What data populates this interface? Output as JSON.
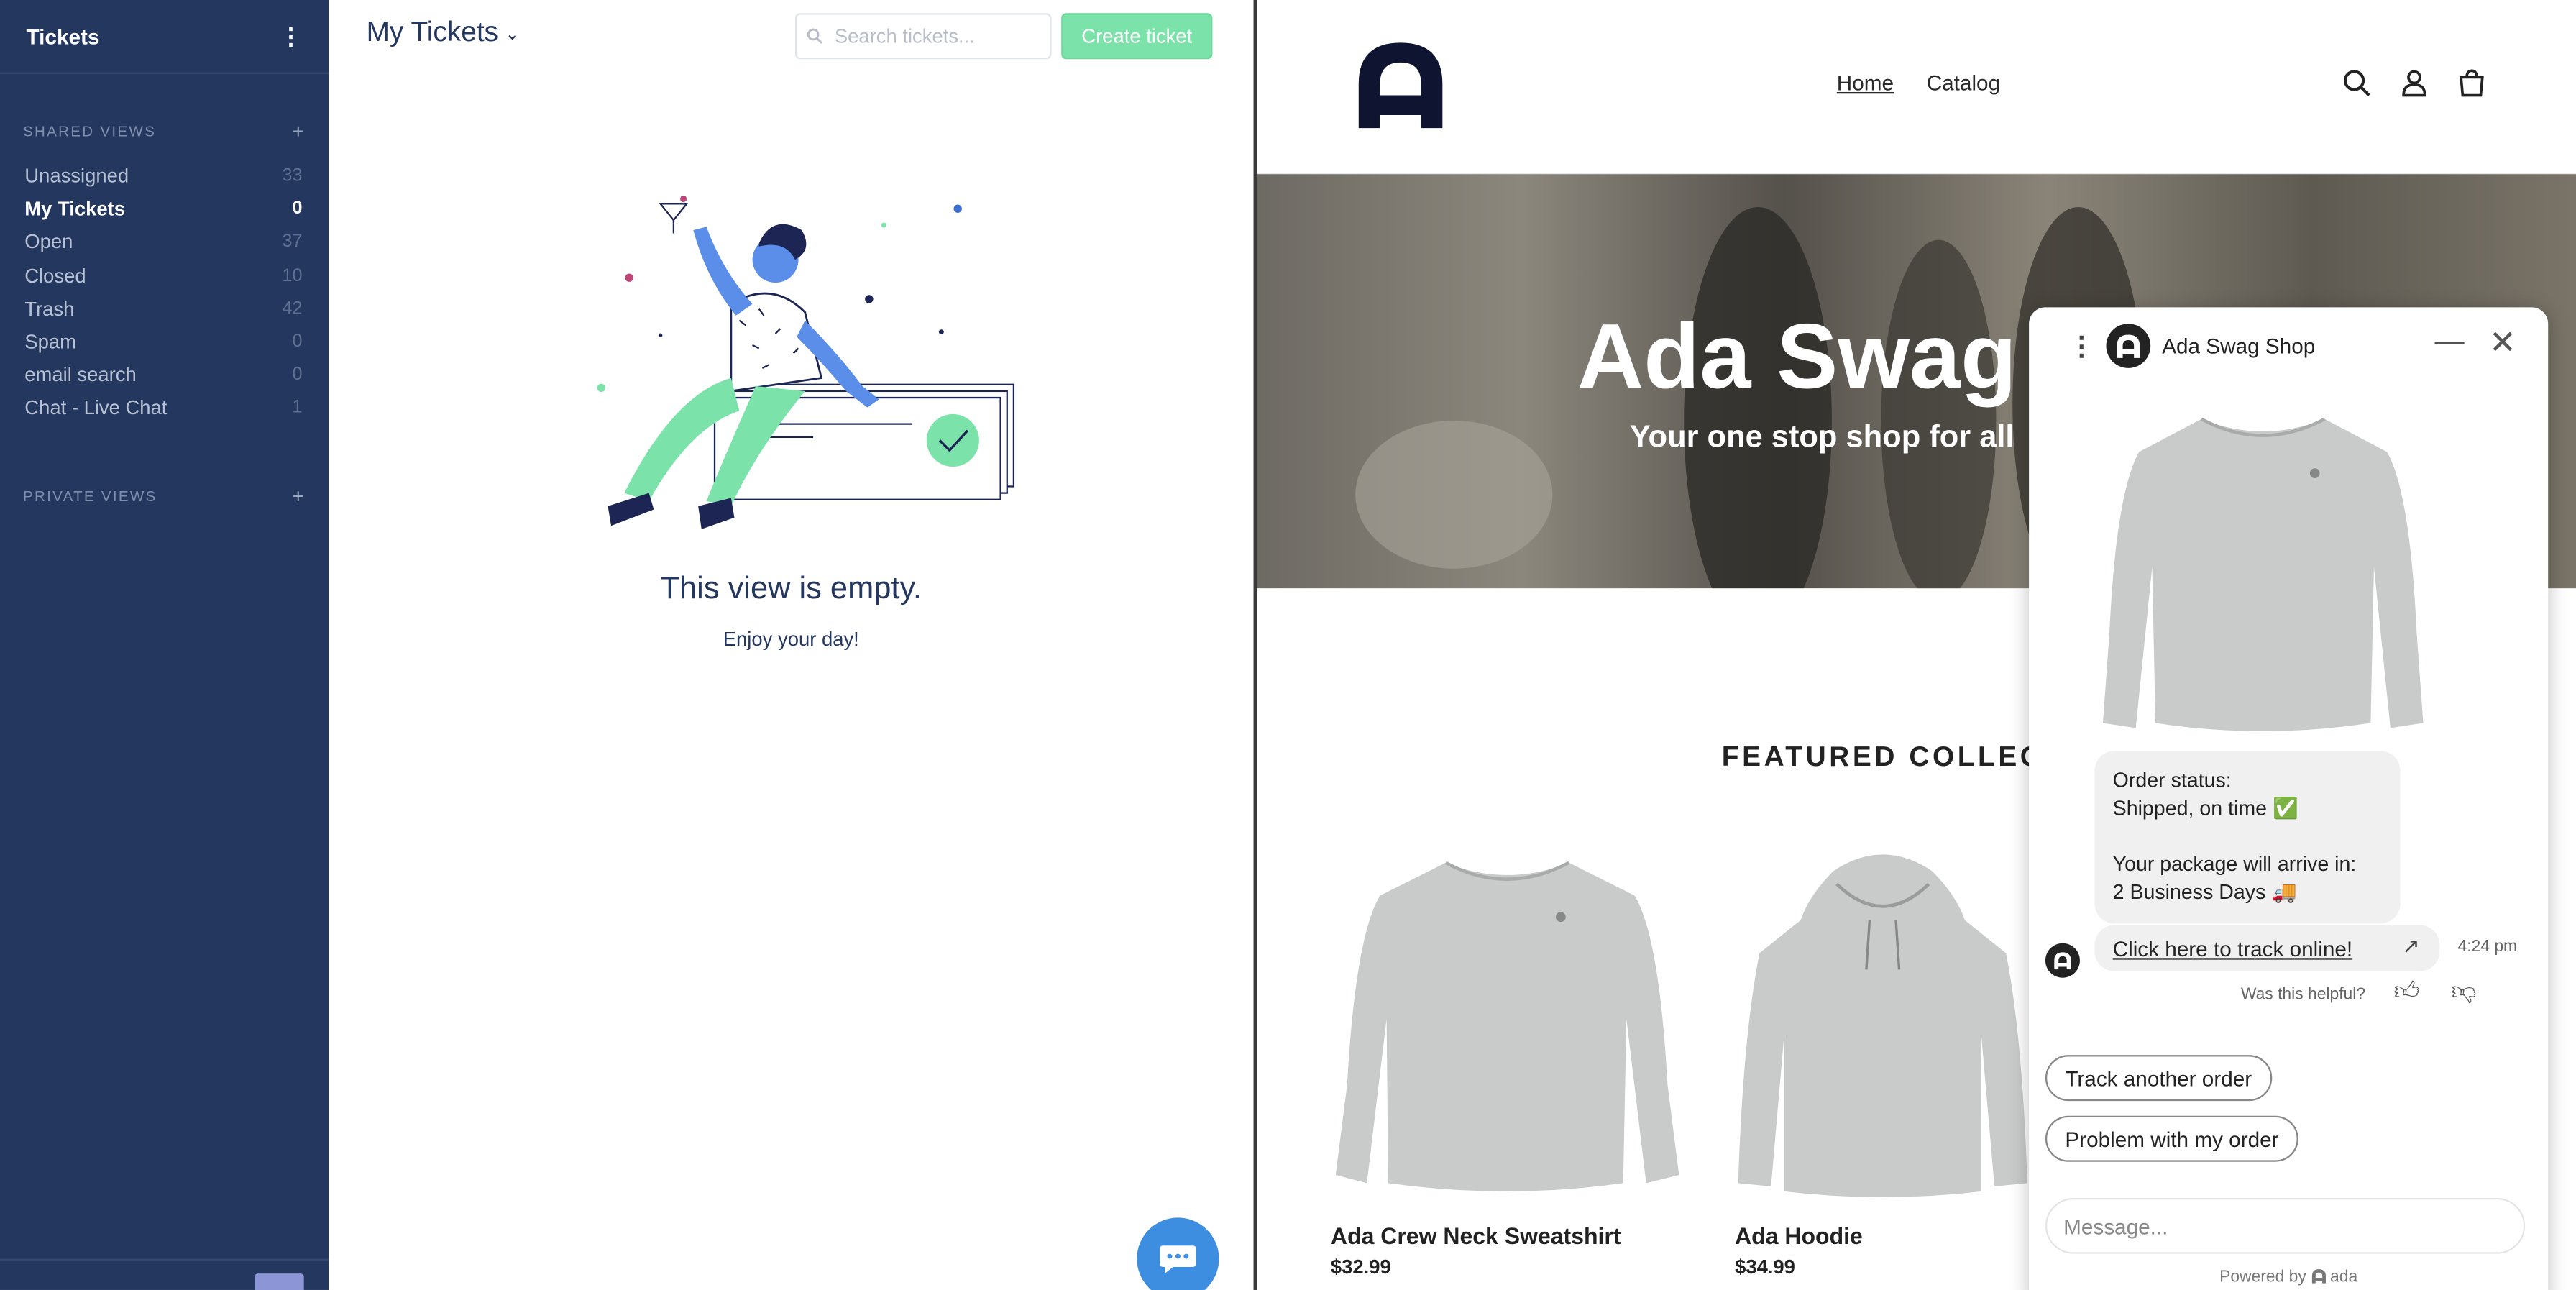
{
  "sidebar": {
    "title": "Tickets",
    "shared_views_label": "SHARED VIEWS",
    "private_views_label": "PRIVATE VIEWS",
    "items": [
      {
        "label": "Unassigned",
        "count": "33"
      },
      {
        "label": "My Tickets",
        "count": "0"
      },
      {
        "label": "Open",
        "count": "37"
      },
      {
        "label": "Closed",
        "count": "10"
      },
      {
        "label": "Trash",
        "count": "42"
      },
      {
        "label": "Spam",
        "count": "0"
      },
      {
        "label": "email search",
        "count": "0"
      },
      {
        "label": "Chat - Live Chat",
        "count": "1"
      }
    ]
  },
  "tickets": {
    "view_title": "My Tickets",
    "search_placeholder": "Search tickets...",
    "create_button": "Create ticket",
    "empty_title": "This view is empty.",
    "empty_subtitle": "Enjoy your day!"
  },
  "store": {
    "nav": {
      "home": "Home",
      "catalog": "Catalog"
    },
    "hero_title": "Ada Swag",
    "hero_subtitle": "Your one stop shop for all",
    "featured_title": "FEATURED COLLEC",
    "products": [
      {
        "name": "Ada Crew Neck Sweatshirt",
        "price": "$32.99"
      },
      {
        "name": "Ada Hoodie",
        "price": "$34.99"
      }
    ]
  },
  "chat": {
    "title": "Ada Swag Shop",
    "status_line1": "Order status:",
    "status_line2": "Shipped, on time ✅",
    "status_line3": "Your package will arrive in:",
    "status_line4": "2 Business Days 🚚",
    "track_link": "Click here to track online!",
    "time": "4:24 pm",
    "helpful": "Was this helpful?",
    "quick_replies": [
      "Track another order",
      "Problem with my order"
    ],
    "input_placeholder": "Message...",
    "powered_by": "Powered by",
    "brand": "ada"
  },
  "colors": {
    "sidebar_bg": "#24375f",
    "create_button": "#7be3a9",
    "chat_launcher": "#3d8de0"
  }
}
